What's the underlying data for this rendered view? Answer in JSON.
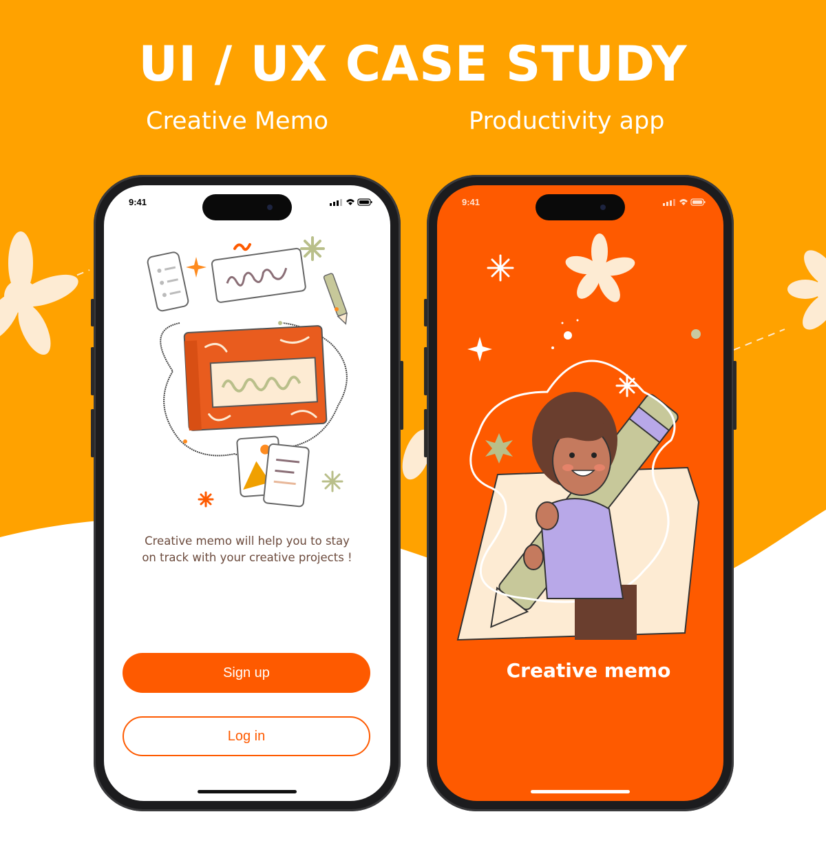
{
  "header": {
    "title": "UI / UX CASE STUDY",
    "subtitle_left": "Creative Memo",
    "subtitle_right": "Productivity app"
  },
  "colors": {
    "brand_yellow": "#FFA200",
    "brand_orange": "#FE5A00",
    "cream": "#FDEBD3",
    "sage": "#B9BF8A"
  },
  "phone_onboarding": {
    "status_time": "9:41",
    "tagline_line1": "Creative memo will help you to stay",
    "tagline_line2": "on track with your creative projects !",
    "signup_label": "Sign up",
    "login_label": "Log in"
  },
  "phone_splash": {
    "status_time": "9:41",
    "app_name": "Creative memo"
  }
}
